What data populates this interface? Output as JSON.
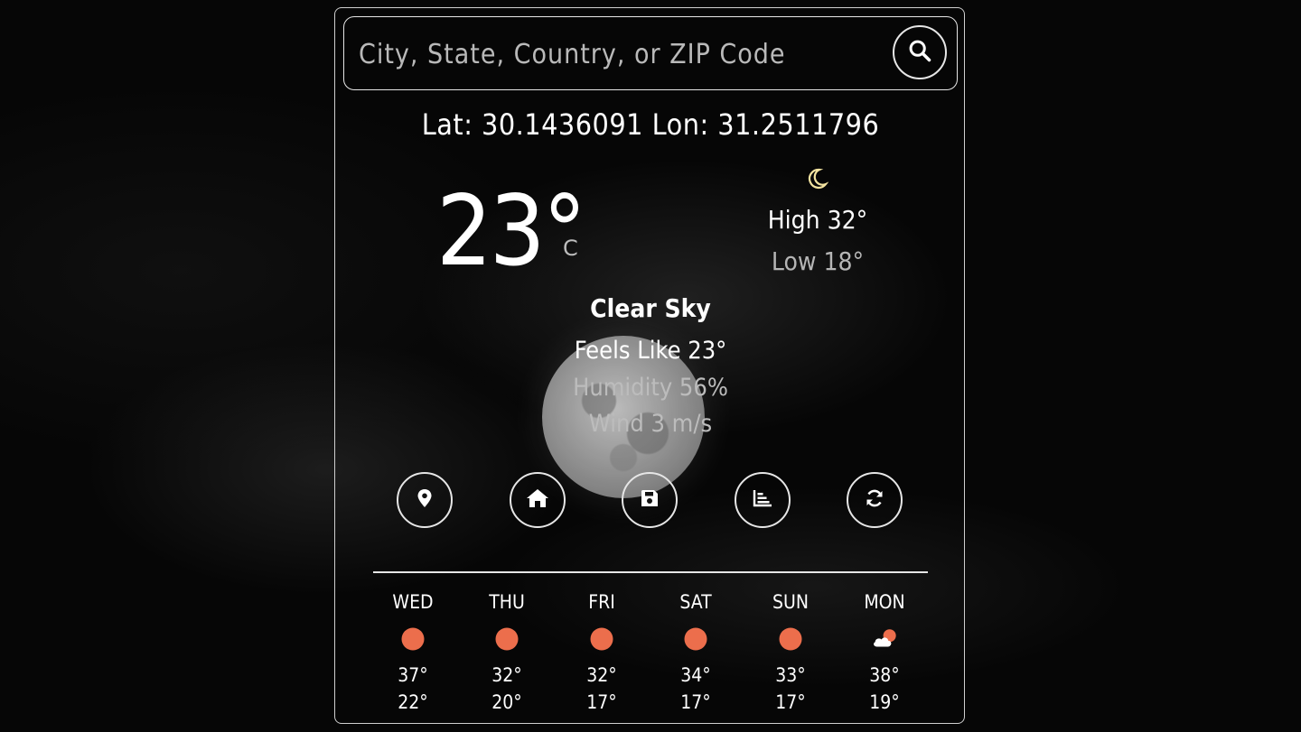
{
  "search": {
    "placeholder": "City, State, Country, or ZIP Code"
  },
  "location": {
    "text": "Lat: 30.1436091 Lon: 31.2511796"
  },
  "current": {
    "temp": "23°",
    "unit": "C",
    "high": "High 32°",
    "low": "Low 18°",
    "condition": "Clear Sky",
    "feels_like": "Feels Like 23°",
    "humidity": "Humidity 56%",
    "wind": "Wind 3 m/s",
    "icon": "crescent-moon-icon"
  },
  "actions": [
    {
      "name": "location-pin-icon"
    },
    {
      "name": "home-icon"
    },
    {
      "name": "save-icon"
    },
    {
      "name": "chart-icon"
    },
    {
      "name": "refresh-icon"
    }
  ],
  "forecast": [
    {
      "day": "WED",
      "icon": "sun-icon",
      "high": "37°",
      "low": "22°"
    },
    {
      "day": "THU",
      "icon": "sun-icon",
      "high": "32°",
      "low": "20°"
    },
    {
      "day": "FRI",
      "icon": "sun-icon",
      "high": "32°",
      "low": "17°"
    },
    {
      "day": "SAT",
      "icon": "sun-icon",
      "high": "34°",
      "low": "17°"
    },
    {
      "day": "SUN",
      "icon": "sun-icon",
      "high": "33°",
      "low": "17°"
    },
    {
      "day": "MON",
      "icon": "partly-cloudy-icon",
      "high": "38°",
      "low": "19°"
    }
  ],
  "colors": {
    "sun": "#ec6e4c",
    "moon": "#f3e3a0",
    "border": "#e6e6e6",
    "muted": "#b5b5b5"
  }
}
